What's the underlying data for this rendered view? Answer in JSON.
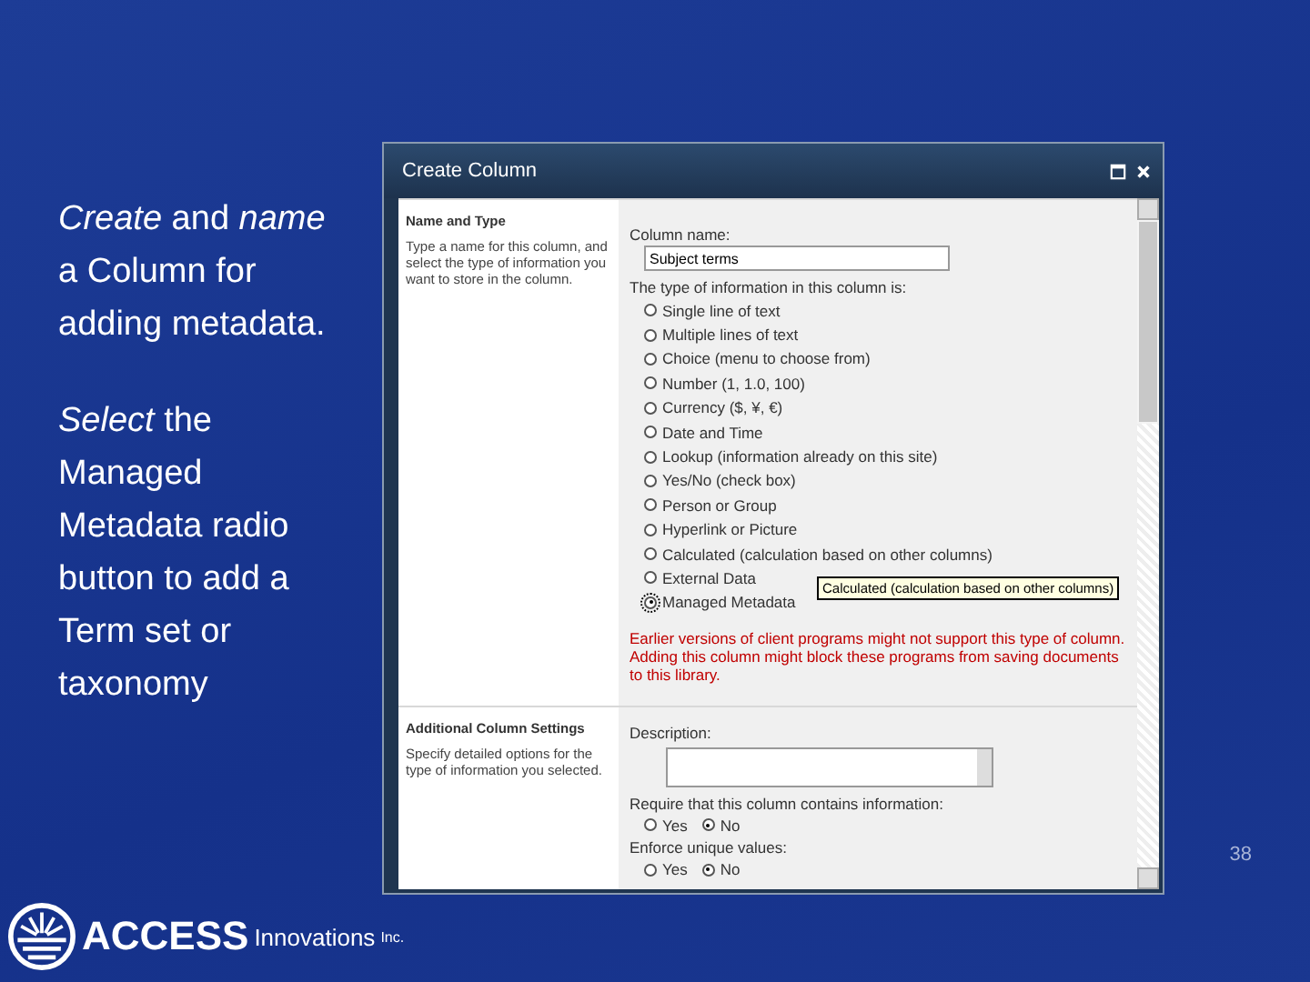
{
  "slide": {
    "paragraphs": [
      "*Create* and *name* a Column for adding metadata.",
      "*Select* the Managed Metadata radio button to add a Term set or taxonomy"
    ],
    "page_number": "38",
    "logo": {
      "brand": "ACCESS",
      "suffix": "Innovations",
      "mark": "Inc."
    }
  },
  "dialog": {
    "title": "Create Column",
    "sections": [
      {
        "heading": "Name and Type",
        "description": "Type a name for this column, and select the type of information you want to store in the column.",
        "fields": [
          {
            "kind": "text",
            "label": "Column name:",
            "value": "Subject terms"
          },
          {
            "kind": "radios",
            "label": "The type of information in this column is:",
            "options": [
              {
                "label": "Single line of text",
                "selected": false
              },
              {
                "label": "Multiple lines of text",
                "selected": false
              },
              {
                "label": "Choice (menu to choose from)",
                "selected": false
              },
              {
                "label": "Number (1, 1.0, 100)",
                "selected": false
              },
              {
                "label": "Currency ($, ¥, €)",
                "selected": false
              },
              {
                "label": "Date and Time",
                "selected": false
              },
              {
                "label": "Lookup (information already on this site)",
                "selected": false
              },
              {
                "label": "Yes/No (check box)",
                "selected": false
              },
              {
                "label": "Person or Group",
                "selected": false
              },
              {
                "label": "Hyperlink or Picture",
                "selected": false
              },
              {
                "label": "Calculated (calculation based on other columns)",
                "selected": false
              },
              {
                "label": "External Data",
                "selected": false
              },
              {
                "label": "Managed Metadata",
                "selected": true
              }
            ]
          },
          {
            "kind": "warning",
            "text": "Earlier versions of client programs might not support this type of column. Adding this column might block these programs from saving documents to this library."
          }
        ]
      },
      {
        "heading": "Additional Column Settings",
        "description": "Specify detailed options for the type of information you selected.",
        "fields": [
          {
            "kind": "textarea",
            "label": "Description:"
          },
          {
            "kind": "inline",
            "label": "Require that this column contains information:",
            "options": [
              {
                "label": "Yes",
                "selected": false
              },
              {
                "label": "No",
                "selected": true
              }
            ]
          },
          {
            "kind": "inline",
            "label": "Enforce unique values:",
            "options": [
              {
                "label": "Yes",
                "selected": false
              },
              {
                "label": "No",
                "selected": true
              }
            ]
          }
        ]
      }
    ],
    "tooltip": "Calculated (calculation based on other columns)"
  }
}
